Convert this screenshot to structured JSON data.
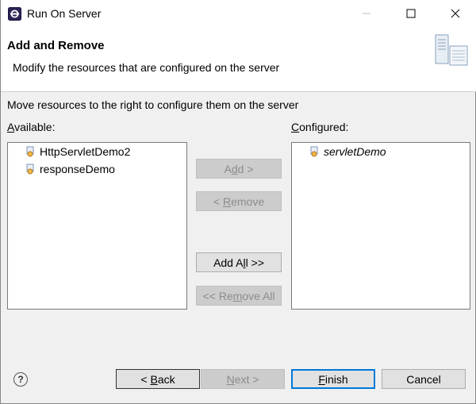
{
  "window": {
    "title": "Run On Server",
    "controls": {
      "minimize": "minimize",
      "maximize": "maximize",
      "close": "close"
    }
  },
  "banner": {
    "title": "Add and Remove",
    "description": "Modify the resources that are configured on the server",
    "icon": "server-icon"
  },
  "instructions": "Move resources to the right to configure them on the server",
  "available": {
    "label_prefix": "",
    "label_mnemonic": "A",
    "label_rest": "vailable:",
    "items": [
      {
        "label": "HttpServletDemo2",
        "icon": "web-module-icon"
      },
      {
        "label": "responseDemo",
        "icon": "web-module-icon"
      }
    ]
  },
  "configured": {
    "label_prefix": "",
    "label_mnemonic": "C",
    "label_rest": "onfigured:",
    "items": [
      {
        "label": "servletDemo",
        "icon": "web-module-icon"
      }
    ]
  },
  "buttons": {
    "add": {
      "pre": "A",
      "mn": "d",
      "post": "d >",
      "enabled": false
    },
    "remove": {
      "pre": "< ",
      "mn": "R",
      "post": "emove",
      "enabled": false
    },
    "add_all": {
      "pre": "Add A",
      "mn": "l",
      "post": "l >>",
      "enabled": true
    },
    "remove_all": {
      "pre": "<< Re",
      "mn": "m",
      "post": "ove All",
      "enabled": false
    },
    "back": {
      "pre": "< ",
      "mn": "B",
      "post": "ack",
      "enabled": true
    },
    "next": {
      "pre": "",
      "mn": "N",
      "post": "ext >",
      "enabled": false
    },
    "finish": {
      "pre": "",
      "mn": "F",
      "post": "inish",
      "enabled": true
    },
    "cancel": {
      "label": "Cancel",
      "enabled": true
    }
  },
  "help": {
    "symbol": "?"
  },
  "colors": {
    "accent": "#0078d7",
    "disabled_text": "#8c8c8c",
    "background": "#f0f0f0"
  }
}
